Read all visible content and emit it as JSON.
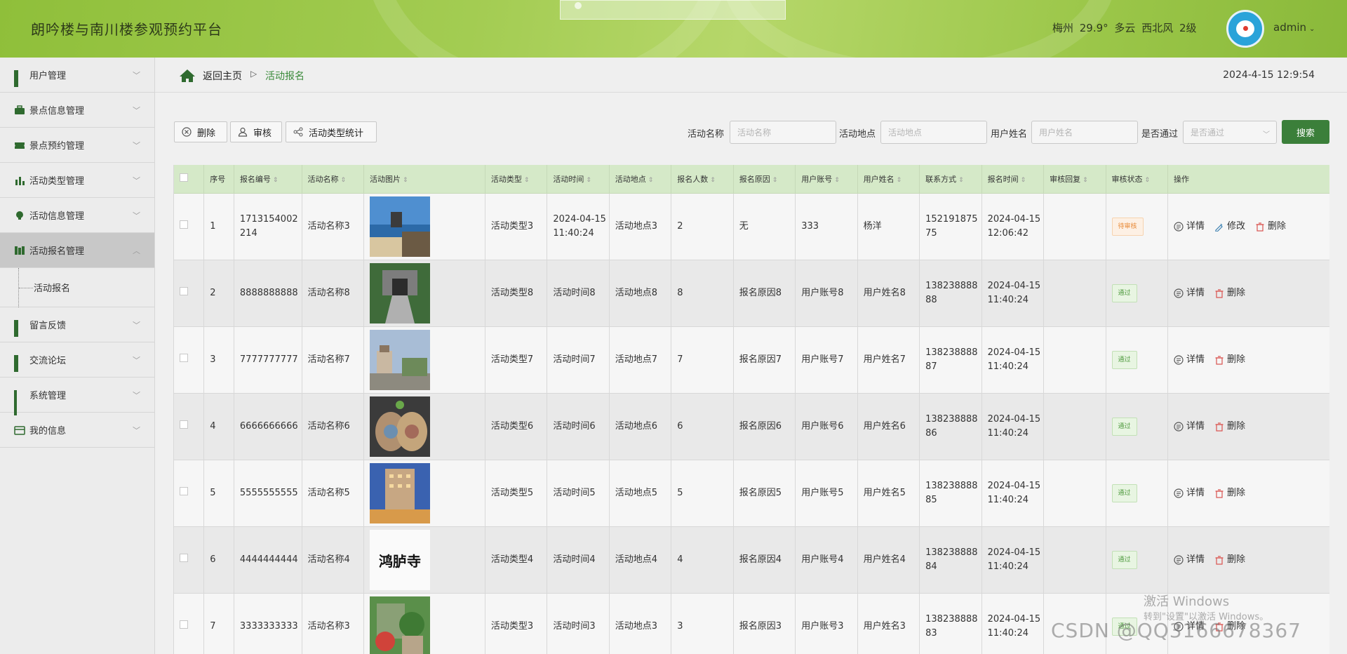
{
  "header": {
    "title": "朗吟楼与南川楼参观预约平台",
    "weather": "梅州  29.9°  多云  西北风  2级",
    "user": "admin"
  },
  "sidebar": {
    "items": [
      {
        "label": "用户管理",
        "icon": "grid-icon"
      },
      {
        "label": "景点信息管理",
        "icon": "briefcase-icon"
      },
      {
        "label": "景点预约管理",
        "icon": "ticket-icon"
      },
      {
        "label": "活动类型管理",
        "icon": "bar-chart-icon"
      },
      {
        "label": "活动信息管理",
        "icon": "bulb-icon"
      },
      {
        "label": "活动报名管理",
        "icon": "book-icon"
      },
      {
        "label": "留言反馈",
        "icon": "grid-icon"
      },
      {
        "label": "交流论坛",
        "icon": "grid-icon"
      },
      {
        "label": "系统管理",
        "icon": "grid9-icon"
      },
      {
        "label": "我的信息",
        "icon": "card-icon"
      }
    ],
    "sub_item": "活动报名"
  },
  "breadcrumb": {
    "home": "返回主页",
    "separator": "▷",
    "current": "活动报名",
    "datetime": "2024-4-15 12:9:54"
  },
  "toolbar": {
    "delete": "删除",
    "review": "审核",
    "stats": "活动类型统计"
  },
  "search": {
    "activity_name_label": "活动名称",
    "activity_name_placeholder": "活动名称",
    "activity_place_label": "活动地点",
    "activity_place_placeholder": "活动地点",
    "user_name_label": "用户姓名",
    "user_name_placeholder": "用户姓名",
    "passed_label": "是否通过",
    "passed_placeholder": "是否通过",
    "button": "搜索"
  },
  "table": {
    "columns": [
      "序号",
      "报名编号",
      "活动名称",
      "活动图片",
      "活动类型",
      "活动时间",
      "活动地点",
      "报名人数",
      "报名原因",
      "用户账号",
      "用户姓名",
      "联系方式",
      "报名时间",
      "审核回复",
      "审核状态",
      "操作"
    ],
    "rows": [
      {
        "no": "1",
        "code": "1713154002214",
        "name": "活动名称3",
        "type": "活动类型3",
        "time": "2024-04-15 11:40:24",
        "place": "活动地点3",
        "count": "2",
        "reason": "无",
        "account": "333",
        "uname": "杨洋",
        "phone": "15219187575",
        "signup": "2024-04-15 12:06:42",
        "reply": "",
        "status": "待审核",
        "status_kind": "pending",
        "ops": [
          "详情",
          "修改",
          "删除"
        ],
        "img": "seaside"
      },
      {
        "no": "2",
        "code": "8888888888",
        "name": "活动名称8",
        "type": "活动类型8",
        "time": "活动时间8",
        "place": "活动地点8",
        "count": "8",
        "reason": "报名原因8",
        "account": "用户账号8",
        "uname": "用户姓名8",
        "phone": "13823888888",
        "signup": "2024-04-15 11:40:24",
        "reply": "",
        "status": "通过",
        "status_kind": "pass",
        "ops": [
          "详情",
          "删除"
        ],
        "img": "gate"
      },
      {
        "no": "3",
        "code": "7777777777",
        "name": "活动名称7",
        "type": "活动类型7",
        "time": "活动时间7",
        "place": "活动地点7",
        "count": "7",
        "reason": "报名原因7",
        "account": "用户账号7",
        "uname": "用户姓名7",
        "phone": "13823888887",
        "signup": "2024-04-15 11:40:24",
        "reply": "",
        "status": "通过",
        "status_kind": "pass",
        "ops": [
          "详情",
          "删除"
        ],
        "img": "tower"
      },
      {
        "no": "4",
        "code": "6666666666",
        "name": "活动名称6",
        "type": "活动类型6",
        "time": "活动时间6",
        "place": "活动地点6",
        "count": "6",
        "reason": "报名原因6",
        "account": "用户账号6",
        "uname": "用户姓名6",
        "phone": "13823888886",
        "signup": "2024-04-15 11:40:24",
        "reply": "",
        "status": "通过",
        "status_kind": "pass",
        "ops": [
          "详情",
          "删除"
        ],
        "img": "food"
      },
      {
        "no": "5",
        "code": "5555555555",
        "name": "活动名称5",
        "type": "活动类型5",
        "time": "活动时间5",
        "place": "活动地点5",
        "count": "5",
        "reason": "报名原因5",
        "account": "用户账号5",
        "uname": "用户姓名5",
        "phone": "13823888885",
        "signup": "2024-04-15 11:40:24",
        "reply": "",
        "status": "通过",
        "status_kind": "pass",
        "ops": [
          "详情",
          "删除"
        ],
        "img": "hotel"
      },
      {
        "no": "6",
        "code": "4444444444",
        "name": "活动名称4",
        "type": "活动类型4",
        "time": "活动时间4",
        "place": "活动地点4",
        "count": "4",
        "reason": "报名原因4",
        "account": "用户账号4",
        "uname": "用户姓名4",
        "phone": "13823888884",
        "signup": "2024-04-15 11:40:24",
        "reply": "",
        "status": "通过",
        "status_kind": "pass",
        "ops": [
          "详情",
          "删除"
        ],
        "img": "calligraphy",
        "img_text": "鸿胪寺"
      },
      {
        "no": "7",
        "code": "3333333333",
        "name": "活动名称3",
        "type": "活动类型3",
        "time": "活动时间3",
        "place": "活动地点3",
        "count": "3",
        "reason": "报名原因3",
        "account": "用户账号3",
        "uname": "用户姓名3",
        "phone": "13823888883",
        "signup": "2024-04-15 11:40:24",
        "reply": "",
        "status": "通过",
        "status_kind": "pass",
        "ops": [
          "详情",
          "删除"
        ],
        "img": "garden"
      }
    ]
  },
  "watermark": {
    "activate": "激活 Windows",
    "activate_sub": "转到\"设置\"以激活 Windows。",
    "csdn": "CSDN @QQ3166678367"
  },
  "colors": {
    "header_green": "#9cc74a",
    "accent_green": "#3b7f3a",
    "table_header": "#d5e9c8",
    "pending": "#e88b3a",
    "pass": "#4f9a3f"
  }
}
